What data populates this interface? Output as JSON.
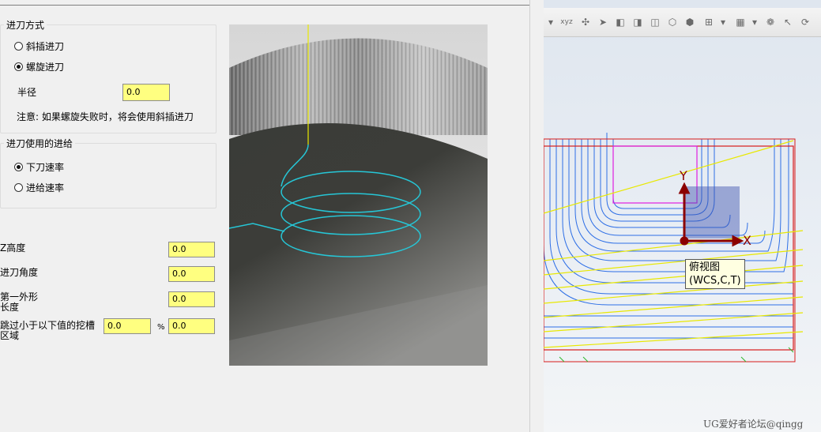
{
  "approach": {
    "title": "进刀方式",
    "options": [
      {
        "label": "斜插进刀",
        "selected": false
      },
      {
        "label": "螺旋进刀",
        "selected": true
      }
    ],
    "radius_label": "半径",
    "radius_value": "0.0",
    "note": "注意: 如果螺旋失败时，将会使用斜插进刀"
  },
  "feed": {
    "title": "进刀使用的进给",
    "options": [
      {
        "label": "下刀速率",
        "selected": true
      },
      {
        "label": "进给速率",
        "selected": false
      }
    ]
  },
  "params": {
    "z_height_label": "Z高度",
    "z_height_value": "0.0",
    "entry_angle_label": "进刀角度",
    "entry_angle_value": "0.0",
    "first_profile_label_line1": "第一外形",
    "first_profile_label_line2": "长度",
    "first_profile_value": "0.0",
    "skip_label_line1": "跳过小于以下值的挖槽",
    "skip_label_line2": "区域",
    "skip_value": "0.0",
    "skip_unit": "%",
    "skip_percent_value": "0.0"
  },
  "cad": {
    "tooltip_line1": "俯视图",
    "tooltip_line2": "(WCS,C,T)",
    "axis_y": "Y",
    "axis_x": "X",
    "toolbar_icons": [
      "dropdown-icon",
      "xyz-icon",
      "point-add-icon",
      "select-arrow-icon",
      "shade-icon",
      "solid-icon",
      "wireframe-icon",
      "box-icon",
      "view-cube-icon",
      "level-icon",
      "dropdown-icon",
      "grid-icon",
      "dropdown-icon",
      "snap-icon",
      "pointer-icon",
      "rotate-icon"
    ],
    "watermark": "UG爱好者论坛@qingg"
  },
  "colors": {
    "field_bg": "#ffff80",
    "helix": "#26c6d6",
    "toolpath": "#2e6fe6",
    "boundary": "#d81b1b",
    "highlight": "#e01ee0",
    "diag": "#e8e800",
    "axis": "#8b0000"
  }
}
